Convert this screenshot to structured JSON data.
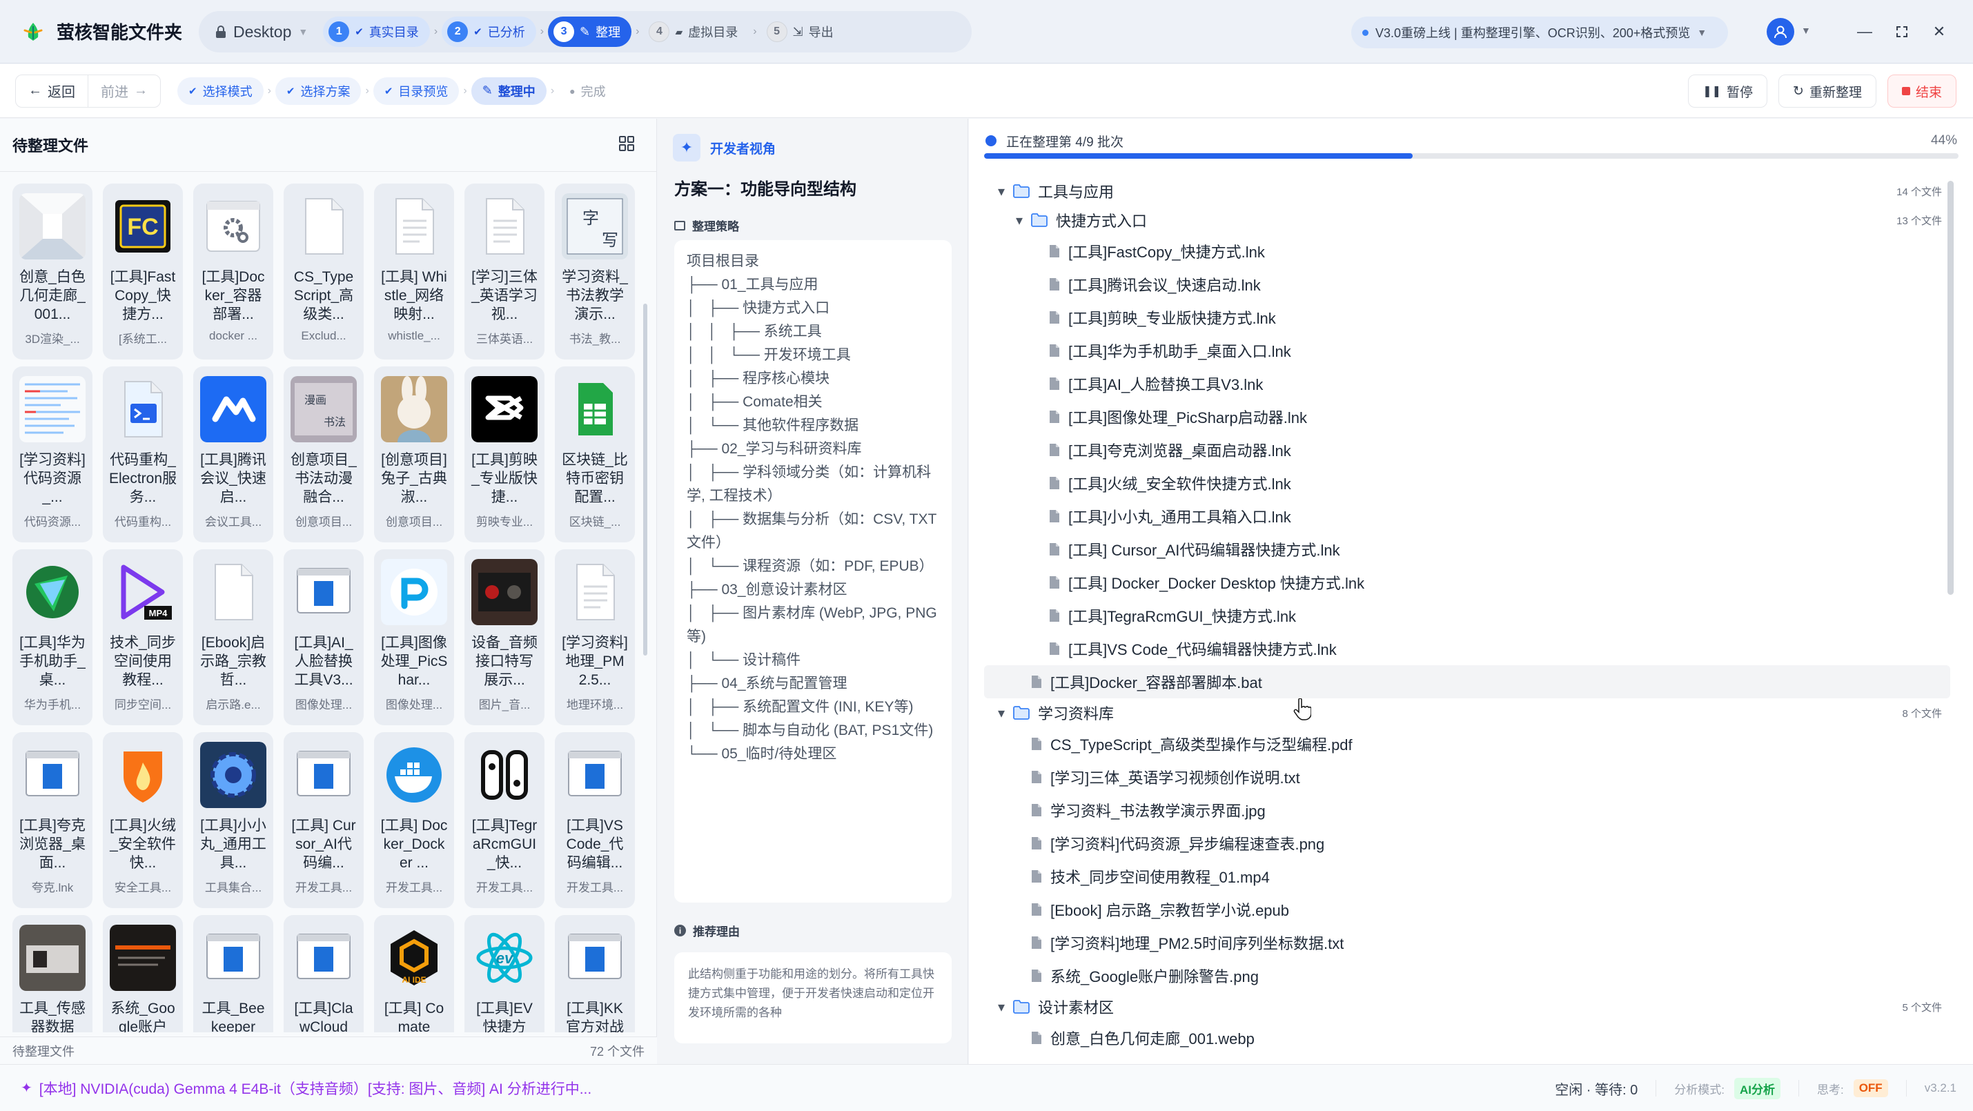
{
  "app": {
    "title": "萤核智能文件夹"
  },
  "header": {
    "location": "Desktop",
    "steps": [
      {
        "num": "1",
        "label": "真实目录",
        "state": "done"
      },
      {
        "num": "2",
        "label": "已分析",
        "state": "done"
      },
      {
        "num": "3",
        "label": "整理",
        "state": "active"
      },
      {
        "num": "4",
        "label": "虚拟目录",
        "state": "todo"
      },
      {
        "num": "5",
        "label": "导出",
        "state": "todo"
      }
    ],
    "notice": "V3.0重磅上线 | 重构整理引擎、OCR识别、200+格式预览"
  },
  "toolbar": {
    "back": "返回",
    "forward": "前进",
    "substeps": [
      {
        "label": "选择模式",
        "state": "done"
      },
      {
        "label": "选择方案",
        "state": "done"
      },
      {
        "label": "目录预览",
        "state": "done"
      },
      {
        "label": "整理中",
        "state": "active"
      },
      {
        "label": "完成",
        "state": "todo"
      }
    ],
    "pause": "暂停",
    "restart": "重新整理",
    "end": "结束"
  },
  "left": {
    "title": "待整理文件",
    "footer_label": "待整理文件",
    "footer_count": "72 个文件",
    "files": [
      {
        "name": "创意_白色几何走廊_001...",
        "meta": "3D渲染_...",
        "icon": "corridor-image"
      },
      {
        "name": "[工具]FastCopy_快捷方...",
        "meta": "[系统工...",
        "icon": "fastcopy-icon"
      },
      {
        "name": "[工具]Docker_容器部署...",
        "meta": "docker ...",
        "icon": "gear-file-icon"
      },
      {
        "name": "CS_TypeScript_高级类...",
        "meta": "Exclud...",
        "icon": "blank-file-icon"
      },
      {
        "name": "[工具] Whistle_网络映射...",
        "meta": "whistle_...",
        "icon": "text-file-icon"
      },
      {
        "name": "[学习]三体_英语学习视...",
        "meta": "三体英语...",
        "icon": "text-file-icon"
      },
      {
        "name": "学习资料_书法教学演示...",
        "meta": "书法_教...",
        "icon": "calligraphy-image"
      },
      {
        "name": "[学习资料]代码资源_...",
        "meta": "代码资源...",
        "icon": "code-sheet-image"
      },
      {
        "name": "代码重构_Electron服务...",
        "meta": "代码重构...",
        "icon": "powershell-file-icon"
      },
      {
        "name": "[工具]腾讯会议_快速启...",
        "meta": "会议工具...",
        "icon": "tencent-meeting-icon"
      },
      {
        "name": "创意项目_书法动漫融合...",
        "meta": "创意项目...",
        "icon": "calligraphy-anime-image"
      },
      {
        "name": "[创意项目]兔子_古典淑...",
        "meta": "创意项目...",
        "icon": "rabbit-image"
      },
      {
        "name": "[工具]剪映_专业版快捷...",
        "meta": "剪映专业...",
        "icon": "capcut-icon"
      },
      {
        "name": "区块链_比特币密钥配置...",
        "meta": "区块链_...",
        "icon": "sheet-icon"
      },
      {
        "name": "[工具]华为手机助手_桌...",
        "meta": "华为手机...",
        "icon": "huawei-assistant-icon"
      },
      {
        "name": "技术_同步空间使用教程...",
        "meta": "同步空间...",
        "icon": "mp4-icon"
      },
      {
        "name": "[Ebook]启示路_宗教哲...",
        "meta": "启示路.e...",
        "icon": "blank-file-icon"
      },
      {
        "name": "[工具]AI_人脸替换工具V3...",
        "meta": "图像处理...",
        "icon": "window-icon"
      },
      {
        "name": "[工具]图像处理_PicShar...",
        "meta": "图像处理...",
        "icon": "picsharp-icon"
      },
      {
        "name": "设备_音频接口特写展示...",
        "meta": "图片_音...",
        "icon": "audio-device-image"
      },
      {
        "name": "[学习资料]地理_PM2.5...",
        "meta": "地理环境...",
        "icon": "text-file-icon"
      },
      {
        "name": "[工具]夸克浏览器_桌面...",
        "meta": "夸克.lnk",
        "icon": "window-icon"
      },
      {
        "name": "[工具]火绒_安全软件快...",
        "meta": "安全工具...",
        "icon": "huorong-icon"
      },
      {
        "name": "[工具]小小丸_通用工具...",
        "meta": "工具集合...",
        "icon": "gear-app-icon"
      },
      {
        "name": "[工具] Cursor_AI代码编...",
        "meta": "开发工具...",
        "icon": "window-icon"
      },
      {
        "name": "[工具] Docker_Docker ...",
        "meta": "开发工具...",
        "icon": "docker-icon"
      },
      {
        "name": "[工具]TegraRcmGUI_快...",
        "meta": "开发工具...",
        "icon": "switch-icon"
      },
      {
        "name": "[工具]VS Code_代码编辑...",
        "meta": "开发工具...",
        "icon": "window-icon"
      },
      {
        "name": "工具_传感器数据",
        "meta": "",
        "icon": "sensor-image"
      },
      {
        "name": "系统_Google账户",
        "meta": "",
        "icon": "dark-screen-image"
      },
      {
        "name": "工具_Beekeeper",
        "meta": "",
        "icon": "window-icon"
      },
      {
        "name": "[工具]ClawCloud",
        "meta": "",
        "icon": "window-icon"
      },
      {
        "name": "[工具] Comate",
        "meta": "",
        "icon": "comate-icon"
      },
      {
        "name": "[工具]EV快捷方",
        "meta": "",
        "icon": "ev-icon"
      },
      {
        "name": "[工具]KK官方对战",
        "meta": "",
        "icon": "window-icon"
      }
    ]
  },
  "middle": {
    "view_label": "开发者视角",
    "plan_title": "方案一：功能导向型结构",
    "strategy_label": "整理策略",
    "tree_lines": [
      "项目根目录",
      "├── 01_工具与应用",
      "│   ├── 快捷方式入口",
      "│   │   ├── 系统工具",
      "│   │   └── 开发环境工具",
      "│   ├── 程序核心模块",
      "│   ├── Comate相关",
      "│   └── 其他软件程序数据",
      "├── 02_学习与科研资料库",
      "│   ├── 学科领域分类（如：计算机科学, 工程技术）",
      "│   ├── 数据集与分析（如：CSV, TXT文件）",
      "│   └── 课程资源（如：PDF, EPUB）",
      "├── 03_创意设计素材区",
      "│   ├── 图片素材库 (WebP, JPG, PNG等)",
      "│   └── 设计稿件",
      "├── 04_系统与配置管理",
      "│   ├── 系统配置文件 (INI, KEY等)",
      "│   └── 脚本与自动化 (BAT, PS1文件)",
      "└── 05_临时/待处理区"
    ],
    "reason_label": "推荐理由",
    "reason_text": "此结构侧重于功能和用途的划分。将所有工具快捷方式集中管理，便于开发者快速启动和定位开发环境所需的各种"
  },
  "right": {
    "progress_text": "正在整理第 4/9 批次",
    "progress_pct": "44%",
    "progress_value": 0.44,
    "tree": [
      {
        "type": "folder",
        "level": 0,
        "label": "工具与应用",
        "count": "14 个文件"
      },
      {
        "type": "folder",
        "level": 1,
        "label": "快捷方式入口",
        "count": "13 个文件"
      },
      {
        "type": "file",
        "level": 2,
        "label": "[工具]FastCopy_快捷方式.lnk"
      },
      {
        "type": "file",
        "level": 2,
        "label": "[工具]腾讯会议_快速启动.lnk"
      },
      {
        "type": "file",
        "level": 2,
        "label": "[工具]剪映_专业版快捷方式.lnk"
      },
      {
        "type": "file",
        "level": 2,
        "label": "[工具]华为手机助手_桌面入口.lnk"
      },
      {
        "type": "file",
        "level": 2,
        "label": "[工具]AI_人脸替换工具V3.lnk"
      },
      {
        "type": "file",
        "level": 2,
        "label": "[工具]图像处理_PicSharp启动器.lnk"
      },
      {
        "type": "file",
        "level": 2,
        "label": "[工具]夸克浏览器_桌面启动器.lnk"
      },
      {
        "type": "file",
        "level": 2,
        "label": "[工具]火绒_安全软件快捷方式.lnk"
      },
      {
        "type": "file",
        "level": 2,
        "label": "[工具]小小丸_通用工具箱入口.lnk"
      },
      {
        "type": "file",
        "level": 2,
        "label": "[工具] Cursor_AI代码编辑器快捷方式.lnk"
      },
      {
        "type": "file",
        "level": 2,
        "label": "[工具] Docker_Docker Desktop 快捷方式.lnk"
      },
      {
        "type": "file",
        "level": 2,
        "label": "[工具]TegraRcmGUI_快捷方式.lnk"
      },
      {
        "type": "file",
        "level": 2,
        "label": "[工具]VS Code_代码编辑器快捷方式.lnk"
      },
      {
        "type": "file",
        "level": 1,
        "label": "[工具]Docker_容器部署脚本.bat",
        "hover": true
      },
      {
        "type": "folder",
        "level": 0,
        "label": "学习资料库",
        "count": "8 个文件"
      },
      {
        "type": "file",
        "level": 1,
        "label": "CS_TypeScript_高级类型操作与泛型编程.pdf"
      },
      {
        "type": "file",
        "level": 1,
        "label": "[学习]三体_英语学习视频创作说明.txt"
      },
      {
        "type": "file",
        "level": 1,
        "label": "学习资料_书法教学演示界面.jpg"
      },
      {
        "type": "file",
        "level": 1,
        "label": "[学习资料]代码资源_异步编程速查表.png"
      },
      {
        "type": "file",
        "level": 1,
        "label": "技术_同步空间使用教程_01.mp4"
      },
      {
        "type": "file",
        "level": 1,
        "label": "[Ebook] 启示路_宗教哲学小说.epub"
      },
      {
        "type": "file",
        "level": 1,
        "label": "[学习资料]地理_PM2.5时间序列坐标数据.txt"
      },
      {
        "type": "file",
        "level": 1,
        "label": "系统_Google账户删除警告.png"
      },
      {
        "type": "folder",
        "level": 0,
        "label": "设计素材区",
        "count": "5 个文件"
      },
      {
        "type": "file",
        "level": 1,
        "label": "创意_白色几何走廊_001.webp"
      }
    ]
  },
  "status": {
    "model_text": "[本地] NVIDIA(cuda) Gemma 4 E4B-it（支持音频）[支持: 图片、音频] AI 分析进行中...",
    "queue": "空闲 · 等待: 0",
    "mode_label": "分析模式:",
    "mode_value": "AI分析",
    "think_label": "思考:",
    "think_value": "OFF",
    "version": "v3.2.1"
  },
  "colors": {
    "accent": "#2563eb",
    "purple": "#9333ea",
    "danger": "#ef4444",
    "success": "#16a34a"
  }
}
